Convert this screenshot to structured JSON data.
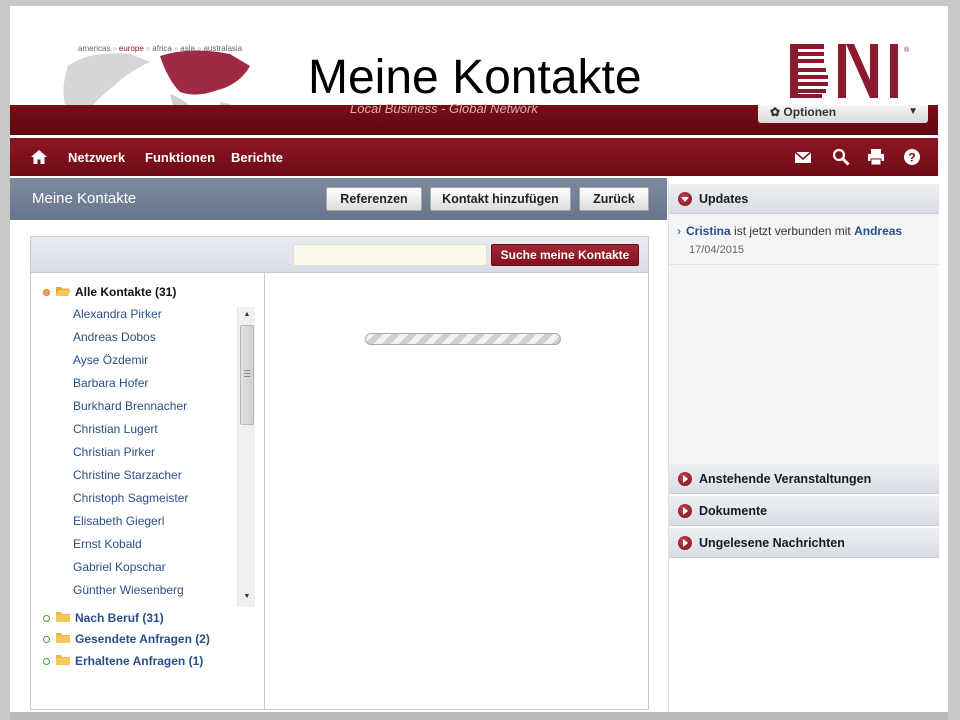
{
  "slide": {
    "title": "Meine Kontakte",
    "continents": [
      "americas",
      "europe",
      "africa",
      "asia",
      "australasia"
    ],
    "active_continent": "europe",
    "banner_text": "Local Business - Global Network",
    "brand": "BNI",
    "registered_mark": "®"
  },
  "header": {
    "options_label": "Optionen"
  },
  "nav": {
    "items": [
      "Netzwerk",
      "Funktionen",
      "Berichte"
    ]
  },
  "page": {
    "title": "Meine Kontakte",
    "buttons": {
      "referrals": "Referenzen",
      "add_contact": "Kontakt hinzufügen",
      "back": "Zurück"
    }
  },
  "search": {
    "value": "",
    "button_label": "Suche meine Kontakte"
  },
  "tree": {
    "all_contacts": "Alle Kontakte (31)",
    "contacts": [
      "Alexandra Pirker",
      "Andreas Dobos",
      "Ayse Özdemir",
      "Barbara Hofer",
      "Burkhard Brennacher",
      "Christian Lugert",
      "Christian Pirker",
      "Christine Starzacher",
      "Christoph Sagmeister",
      "Elisabeth Giegerl",
      "Ernst Kobald",
      "Gabriel Kopschar",
      "Günther Wiesenberg"
    ],
    "groups": [
      "Nach Beruf (31)",
      "Gesendete Anfragen (2)",
      "Erhaltene Anfragen (1)"
    ]
  },
  "sidebar": {
    "updates_title": "Updates",
    "update": {
      "from": "Cristina",
      "text": " ist jetzt verbunden mit ",
      "to": "Andreas",
      "date": "17/04/2015"
    },
    "sections": [
      "Anstehende Veranstaltungen",
      "Dokumente",
      "Ungelesene Nachrichten"
    ]
  },
  "colors": {
    "brand_red": "#7a0c17",
    "link_blue": "#2a4f88",
    "header_gray": "#6f7d93"
  }
}
